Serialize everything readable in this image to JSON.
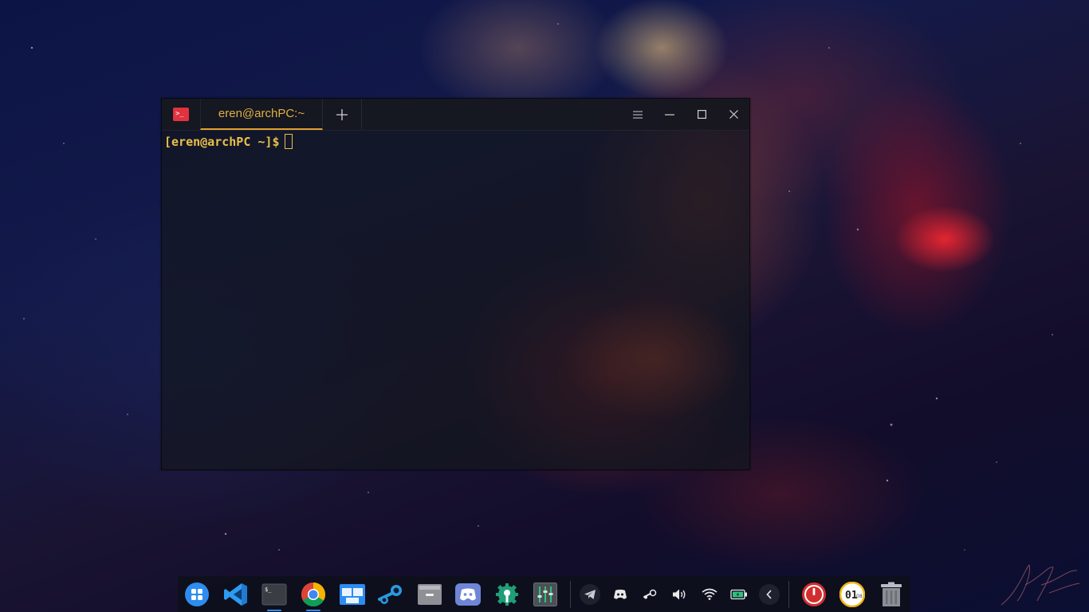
{
  "desktop": {
    "wallpaper": "space-nebula",
    "accent": "#2d8cf0"
  },
  "terminal": {
    "tab_title": "eren@archPC:~",
    "prompt": "[eren@archPC ~]$",
    "tab_accent": "#e0a030",
    "prompt_color": "#e9c047",
    "icon": "terminal-icon"
  },
  "titlebar_controls": [
    "menu-icon",
    "minimize-icon",
    "maximize-icon",
    "close-icon"
  ],
  "dock": {
    "apps": [
      {
        "name": "launcher",
        "icon": "launcher-icon",
        "running": false
      },
      {
        "name": "vscode",
        "icon": "vscode-icon",
        "running": false
      },
      {
        "name": "terminal",
        "icon": "terminal-icon",
        "running": true
      },
      {
        "name": "chrome",
        "icon": "chrome-icon",
        "running": true
      },
      {
        "name": "multitasking",
        "icon": "multitask-icon",
        "running": false
      },
      {
        "name": "steam",
        "icon": "steam-icon",
        "running": false
      },
      {
        "name": "files",
        "icon": "file-manager-icon",
        "running": false
      },
      {
        "name": "discord",
        "icon": "discord-icon",
        "running": false
      },
      {
        "name": "settings",
        "icon": "settings-icon",
        "running": false
      },
      {
        "name": "mixer",
        "icon": "mixer-icon",
        "running": false
      }
    ],
    "tray": [
      "telegram-icon",
      "discord-tray-icon",
      "steam-tray-icon",
      "volume-icon",
      "wifi-icon",
      "battery-icon",
      "collapse-arrow-icon"
    ],
    "clock": {
      "hour": "01",
      "minute": "08"
    }
  }
}
